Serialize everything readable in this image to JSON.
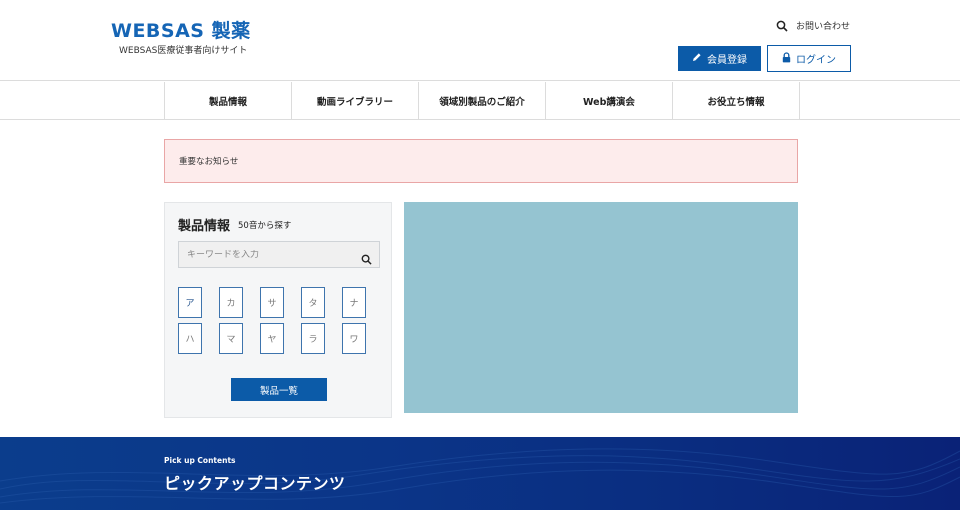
{
  "header": {
    "logo_mark": "WEBSAS 製薬",
    "logo_sub": "WEBSAS医療従事者向けサイト",
    "contact_label": "お問い合わせ",
    "register_label": "会員登録",
    "login_label": "ログイン"
  },
  "nav": {
    "items": [
      {
        "label": "製品情報"
      },
      {
        "label": "動画ライブラリー"
      },
      {
        "label": "領域別製品のご紹介"
      },
      {
        "label": "Web講演会"
      },
      {
        "label": "お役立ち情報"
      }
    ]
  },
  "notice": {
    "text": "重要なお知らせ"
  },
  "products": {
    "title": "製品情報",
    "subtitle": "50音から探す",
    "search_placeholder": "キーワードを入力",
    "kana": [
      "ア",
      "カ",
      "サ",
      "タ",
      "ナ",
      "ハ",
      "マ",
      "ヤ",
      "ラ",
      "ワ"
    ],
    "list_button": "製品一覧"
  },
  "pickup": {
    "label": "Pick up Contents",
    "title": "ピックアップコンテンツ"
  },
  "colors": {
    "brand": "#0c5ba8",
    "notice_bg": "#fdecec",
    "banner": "#95c4d1",
    "pickup_bg": "#0a2d80"
  },
  "icons": {
    "search": "search-icon",
    "pencil": "pencil-icon",
    "lock": "lock-icon"
  }
}
